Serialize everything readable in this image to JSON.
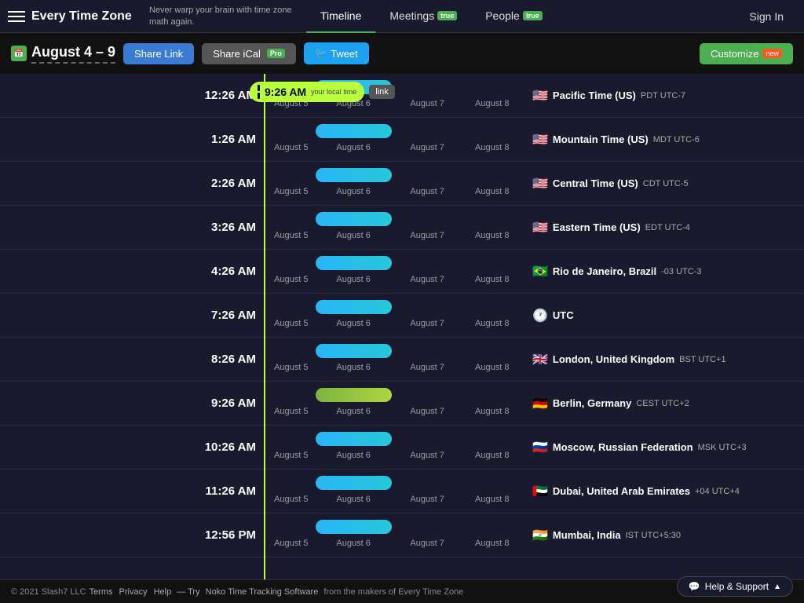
{
  "header": {
    "logo": "Every Time Zone",
    "tagline": "Never warp your brain with time zone math again.",
    "hamburger_label": "menu",
    "nav": [
      {
        "label": "Timeline",
        "id": "timeline",
        "active": true,
        "pro": false
      },
      {
        "label": "Meetings",
        "id": "meetings",
        "active": false,
        "pro": true
      },
      {
        "label": "People",
        "id": "people",
        "active": false,
        "pro": true
      }
    ],
    "sign_in": "Sign In"
  },
  "sub_header": {
    "date_range": "August 4 – 9",
    "share_link": "Share Link",
    "share_ical": "Share iCal",
    "share_ical_pro": "Pro",
    "tweet": "Tweet",
    "customize": "Customize",
    "customize_new": "new"
  },
  "current_time": {
    "time": "9:26 AM",
    "label": "your local time",
    "link": "link"
  },
  "timezones": [
    {
      "time": "12:26 AM",
      "flag": "🇺🇸",
      "name": "Pacific Time (US)",
      "abbr": "PDT",
      "utc": "UTC-7",
      "days": [
        "August 5",
        "August 6",
        "August 7",
        "August 8"
      ]
    },
    {
      "time": "1:26 AM",
      "flag": "🇺🇸",
      "name": "Mountain Time (US)",
      "abbr": "MDT",
      "utc": "UTC-6",
      "days": [
        "August 5",
        "August 6",
        "August 7",
        "August 8"
      ]
    },
    {
      "time": "2:26 AM",
      "flag": "🇺🇸",
      "name": "Central Time (US)",
      "abbr": "CDT",
      "utc": "UTC-5",
      "days": [
        "August 5",
        "August 6",
        "August 7",
        "August 8"
      ]
    },
    {
      "time": "3:26 AM",
      "flag": "🇺🇸",
      "name": "Eastern Time (US)",
      "abbr": "EDT",
      "utc": "UTC-4",
      "days": [
        "August 5",
        "August 6",
        "August 7",
        "August 8"
      ]
    },
    {
      "time": "4:26 AM",
      "flag": "🇧🇷",
      "name": "Rio de Janeiro, Brazil",
      "abbr": "-03",
      "utc": "UTC-3",
      "days": [
        "August 5",
        "August 6",
        "August 7",
        "August 8"
      ]
    },
    {
      "time": "7:26 AM",
      "flag": "🕐",
      "name": "UTC",
      "abbr": "",
      "utc": "",
      "days": [
        "August 5",
        "August 6",
        "August 7",
        "August 8"
      ]
    },
    {
      "time": "8:26 AM",
      "flag": "🇬🇧",
      "name": "London, United Kingdom",
      "abbr": "BST",
      "utc": "UTC+1",
      "days": [
        "August 5",
        "August 6",
        "August 7",
        "August 8"
      ]
    },
    {
      "time": "9:26 AM",
      "flag": "🇩🇪",
      "name": "Berlin, Germany",
      "abbr": "CEST",
      "utc": "UTC+2",
      "days": [
        "August 5",
        "August 6",
        "August 7",
        "August 8"
      ],
      "current": true
    },
    {
      "time": "10:26 AM",
      "flag": "🇷🇺",
      "name": "Moscow, Russian Federation",
      "abbr": "MSK",
      "utc": "UTC+3",
      "days": [
        "August 5",
        "August 6",
        "August 7",
        "August 8"
      ]
    },
    {
      "time": "11:26 AM",
      "flag": "🇦🇪",
      "name": "Dubai, United Arab Emirates",
      "abbr": "+04",
      "utc": "UTC+4",
      "days": [
        "August 5",
        "August 6",
        "August 7",
        "August 8"
      ]
    },
    {
      "time": "12:56 PM",
      "flag": "🇮🇳",
      "name": "Mumbai, India",
      "abbr": "IST",
      "utc": "UTC+5:30",
      "days": [
        "August 5",
        "August 6",
        "August 7",
        "August 8"
      ]
    }
  ],
  "footer": {
    "copyright": "© 2021 Slash7 LLC",
    "terms": "Terms",
    "privacy": "Privacy",
    "help": "Help",
    "try_text": "— Try",
    "noko_text": "Noko Time Tracking Software",
    "from_text": "from the makers of Every Time Zone",
    "help_support": "Help & Support"
  }
}
